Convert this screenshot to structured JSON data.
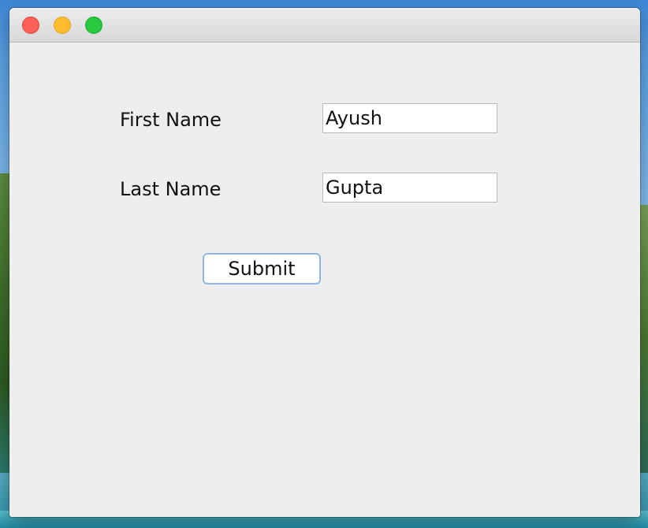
{
  "form": {
    "first_name": {
      "label": "First Name",
      "value": "Ayush"
    },
    "last_name": {
      "label": "Last Name",
      "value": "Gupta"
    },
    "submit_label": "Submit"
  },
  "colors": {
    "window_bg": "#eeeeee",
    "close": "#fe5f57",
    "minimize": "#febc2e",
    "zoom": "#28c840",
    "focus_ring": "#8fb7e6"
  },
  "icons": {
    "close": "close-icon",
    "minimize": "minimize-icon",
    "zoom": "zoom-icon"
  }
}
